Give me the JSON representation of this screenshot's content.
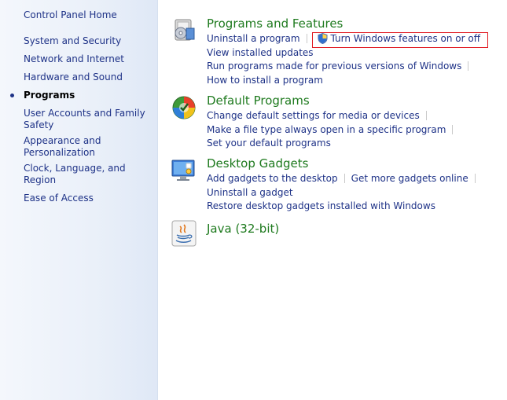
{
  "sidebar": {
    "home": "Control Panel Home",
    "items": [
      {
        "label": "System and Security"
      },
      {
        "label": "Network and Internet"
      },
      {
        "label": "Hardware and Sound"
      },
      {
        "label": "Programs"
      },
      {
        "label_line1": "User Accounts and Family",
        "label_line2": "Safety"
      },
      {
        "label_line1": "Appearance and",
        "label_line2": "Personalization"
      },
      {
        "label": "Clock, Language, and Region"
      },
      {
        "label": "Ease of Access"
      }
    ]
  },
  "sections": {
    "programs_features": {
      "title": "Programs and Features",
      "links": [
        "Uninstall a program",
        "Turn Windows features on or off",
        "View installed updates",
        "Run programs made for previous versions of Windows",
        "How to install a program"
      ]
    },
    "default_programs": {
      "title": "Default Programs",
      "links": [
        "Change default settings for media or devices",
        "Make a file type always open in a specific program",
        "Set your default programs"
      ]
    },
    "desktop_gadgets": {
      "title": "Desktop Gadgets",
      "links": [
        "Add gadgets to the desktop",
        "Get more gadgets online",
        "Uninstall a gadget",
        "Restore desktop gadgets installed with Windows"
      ]
    },
    "java": {
      "title": "Java (32-bit)"
    }
  },
  "colors": {
    "link": "#1e3287",
    "section_title": "#1e7a1e",
    "highlight_border": "#e0161e"
  },
  "icons": [
    "programs-features-icon",
    "default-programs-icon",
    "desktop-gadgets-icon",
    "java-icon",
    "uac-shield-icon"
  ]
}
